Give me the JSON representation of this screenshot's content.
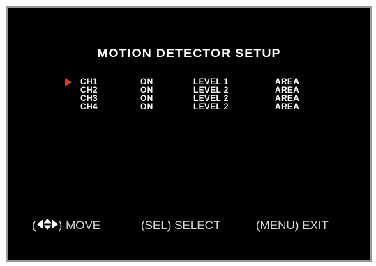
{
  "menu": {
    "title": "MOTION DETECTOR SETUP",
    "selected_index": 0,
    "cursor_icon": "right-arrow-icon",
    "cursor_color": "#e0362a",
    "channels": [
      {
        "channel": "CH1",
        "state": "ON",
        "level": "LEVEL 1",
        "area": "AREA"
      },
      {
        "channel": "CH2",
        "state": "ON",
        "level": "LEVEL 2",
        "area": "AREA"
      },
      {
        "channel": "CH3",
        "state": "ON",
        "level": "LEVEL 2",
        "area": "AREA"
      },
      {
        "channel": "CH4",
        "state": "ON",
        "level": "LEVEL 2",
        "area": "AREA"
      }
    ]
  },
  "footer": {
    "move": {
      "open": "(",
      "icon": "four-way-arrows-icon",
      "close": ")",
      "label": "MOVE"
    },
    "select": {
      "key": "(SEL)",
      "label": "SELECT"
    },
    "exit": {
      "key": "(MENU)",
      "label": "EXIT"
    }
  },
  "colors": {
    "background": "#000000",
    "text": "#ffffff",
    "frame": "#9a9a9a"
  }
}
